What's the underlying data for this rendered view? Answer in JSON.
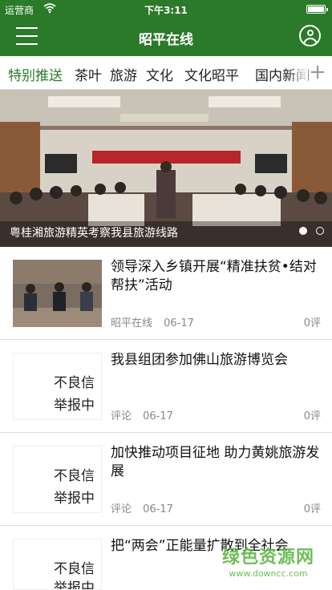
{
  "status_bar": {
    "carrier": "运营商",
    "time": "下午3:11",
    "battery_level": 1.0
  },
  "header": {
    "title": "昭平在线",
    "menu_icon": "hamburger-menu-icon",
    "user_icon": "user-profile-icon"
  },
  "tabs": [
    {
      "label": "特别推送",
      "active": true
    },
    {
      "label": "茶叶"
    },
    {
      "label": "旅游"
    },
    {
      "label": "文化"
    },
    {
      "label": "文化昭平"
    },
    {
      "label": "国内新闻"
    }
  ],
  "add_tab_label": "+",
  "banner": {
    "caption": "粤桂湘旅游精英考察我县旅游线路",
    "slide_count": 2,
    "active_slide": 1
  },
  "news": [
    {
      "title": "领导深入乡镇开展“精准扶贫•结对帮扶”活动",
      "source": "昭平在线",
      "date": "06-17",
      "comments": "0评"
    },
    {
      "title": "我县组团参加佛山旅游博览会",
      "source": "评论",
      "date": "06-17",
      "comments": "0评"
    },
    {
      "title": "加快推动项目征地 助力黄姚旅游发展",
      "source": "评论",
      "date": "06-17",
      "comments": "0评"
    },
    {
      "title": "把“两会”正能量扩散到全社会",
      "source": "",
      "date": "",
      "comments": ""
    }
  ],
  "placeholder_text": {
    "line1": "不良信",
    "line2": "举报中"
  },
  "watermark": {
    "main": "绿色资源网",
    "sub": "www.downcc.com"
  },
  "colors": {
    "brand_green": "#2a7a2a",
    "placeholder_red": "#e02a2a"
  }
}
